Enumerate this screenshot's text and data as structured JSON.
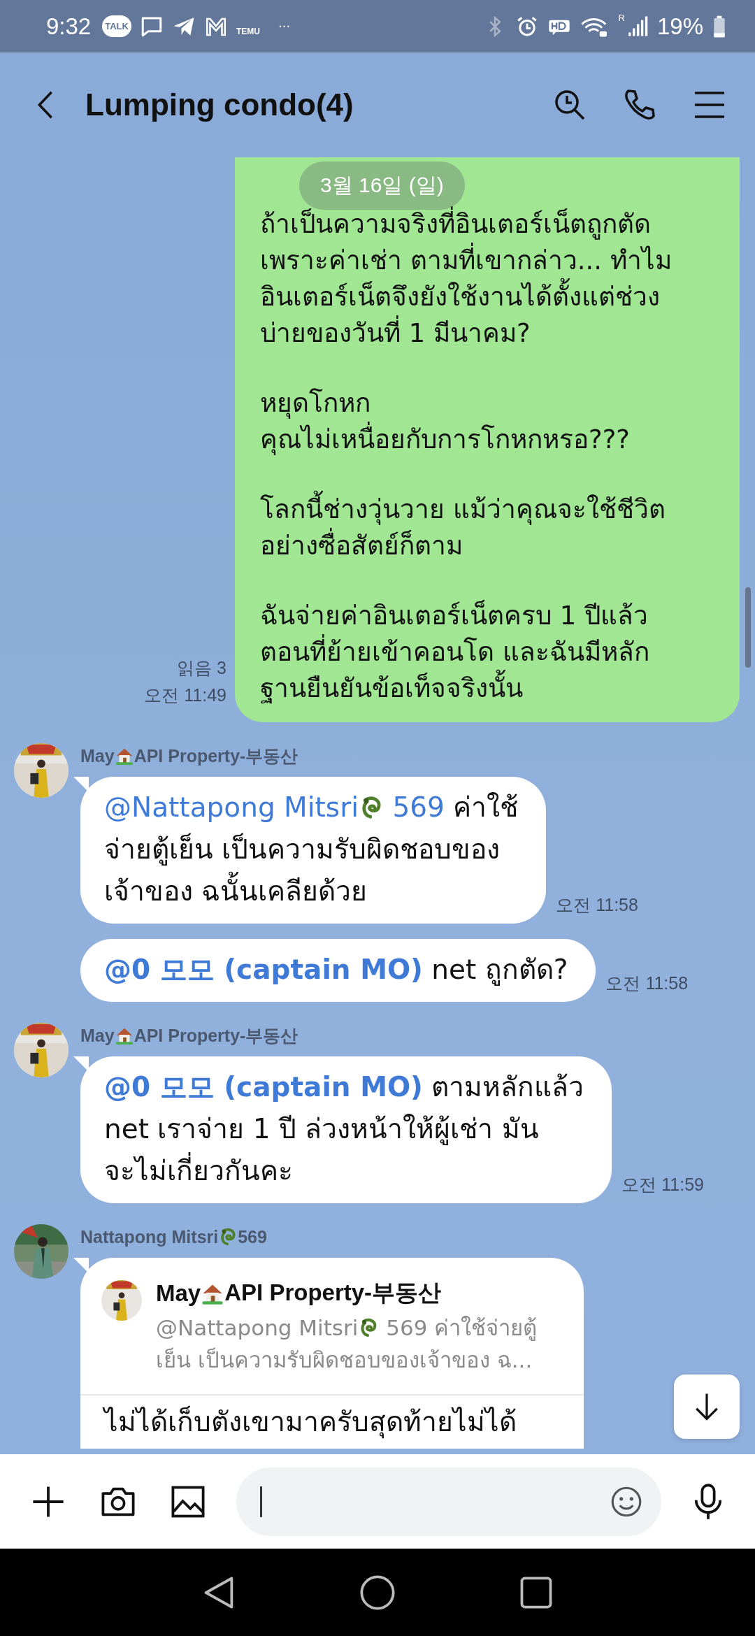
{
  "status_bar": {
    "time": "9:32",
    "notifications": [
      {
        "kind": "talk",
        "label": "TALK"
      },
      {
        "kind": "chat"
      },
      {
        "kind": "telegram"
      },
      {
        "kind": "mail"
      },
      {
        "kind": "temu",
        "label": "TEMU"
      },
      {
        "kind": "more",
        "label": "···"
      }
    ],
    "network_badge": "R",
    "battery_text": "19%"
  },
  "header": {
    "title": "Lumping condo(4)"
  },
  "date_pill": "3월 16일 (일)",
  "messages": [
    {
      "kind": "own",
      "read": "읽음 3",
      "time": "오전 11:49",
      "paragraphs": [
        "ถ้าเป็นความจริงที่อินเตอร์เน็ตถูกตัด\nเพราะค่าเช่า ตามที่เขากล่าว... ทำไม\nอินเตอร์เน็ตจึงยังใช้งานได้ตั้งแต่ช่วง\nบ่ายของวันที่ 1 มีนาคม?",
        "หยุดโกหก\nคุณไม่เหนื่อยกับการโกหกหรอ???",
        "โลกนี้ช่างวุ่นวาย แม้ว่าคุณจะใช้ชีวิต\nอย่างซื่อสัตย์ก็ตาม",
        "ฉันจ่ายค่าอินเตอร์เน็ตครบ 1 ปีแล้ว\nตอนที่ย้ายเข้าคอนโด และฉันมีหลัก\nฐานยืนยันข้อเท็จจริงนั้น"
      ]
    },
    {
      "kind": "incoming",
      "sender": [
        {
          "kind": "text",
          "text": "May"
        },
        {
          "kind": "house"
        },
        {
          "kind": "text",
          "text": "API Property-부동산"
        }
      ],
      "time": "오전 11:58",
      "segments": [
        {
          "kind": "mention",
          "bold": false,
          "parts": [
            {
              "kind": "text",
              "text": "@Nattapong Mitsri"
            },
            {
              "kind": "dragon"
            },
            {
              "kind": "text",
              "text": " 569"
            }
          ]
        },
        {
          "kind": "text",
          "text": " ค่าใช้\nจ่ายตู้เย็น เป็นความรับผิดชอบของ\nเจ้าของ ฉนั้นเคลียด้วย"
        }
      ]
    },
    {
      "kind": "incoming",
      "time": "오전 11:58",
      "segments": [
        {
          "kind": "mention",
          "bold": true,
          "parts": [
            {
              "kind": "text",
              "text": "@0 모모 (captain MO)"
            }
          ]
        },
        {
          "kind": "text",
          "text": " net ถูกตัด?"
        }
      ]
    },
    {
      "kind": "incoming",
      "sender": [
        {
          "kind": "text",
          "text": "May"
        },
        {
          "kind": "house"
        },
        {
          "kind": "text",
          "text": "API Property-부동산"
        }
      ],
      "time": "오전 11:59",
      "segments": [
        {
          "kind": "mention",
          "bold": true,
          "parts": [
            {
              "kind": "text",
              "text": "@0 모모 (captain MO)"
            }
          ]
        },
        {
          "kind": "text",
          "text": " ตามหลักแล้ว\nnet เราจ่าย 1 ปี ล่วงหน้าให้ผู้เช่า มัน\nจะไม่เกี่ยวกันคะ"
        }
      ]
    },
    {
      "kind": "incoming",
      "sender": [
        {
          "kind": "text",
          "text": "Nattapong Mitsri"
        },
        {
          "kind": "dragon"
        },
        {
          "kind": "text",
          "text": "569"
        }
      ],
      "reply": {
        "author": [
          {
            "kind": "text",
            "text": "May"
          },
          {
            "kind": "house"
          },
          {
            "kind": "text",
            "text": "API Property-부동산"
          }
        ],
        "segments": [
          {
            "kind": "mention",
            "bold": false,
            "parts": [
              {
                "kind": "text",
                "text": "@Nattapong Mitsri"
              },
              {
                "kind": "dragon"
              },
              {
                "kind": "text",
                "text": " 569"
              }
            ]
          },
          {
            "kind": "text",
            "text": " ค่าใช้จ่ายตู้\nเย็น เป็นความรับผิดชอบของเจ้าของ ฉ..."
          }
        ]
      },
      "segments": [
        {
          "kind": "text",
          "text": "ไม่ได้เก็บตังเขามาครับสุดท้ายไม่ได้"
        }
      ]
    }
  ]
}
